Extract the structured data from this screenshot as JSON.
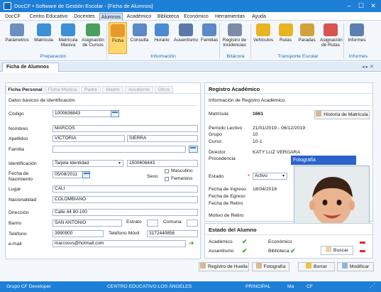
{
  "window": {
    "title": "DocCF • Software de Gestión Escolar - [Ficha de Alumnos]",
    "min": "–",
    "max": "☐",
    "close": "✕"
  },
  "menu": [
    "DocCF",
    "Centro Educativo",
    "Docentes",
    "Alumnos",
    "Académico",
    "Biblioteca",
    "Económico",
    "Herramientas",
    "Ayuda"
  ],
  "ribbon": {
    "buttons": [
      {
        "label": "Parámetros",
        "color": "#6c8fbf"
      },
      {
        "label": "Matrícula",
        "color": "#3d8fd6"
      },
      {
        "label": "Matrícula Masiva",
        "color": "#3d8fd6"
      },
      {
        "label": "Asignación de Cursos",
        "color": "#4aa05a"
      },
      {
        "label": "Ficha",
        "color": "#e79a2a"
      },
      {
        "label": "Consulta",
        "color": "#5b8ac4"
      },
      {
        "label": "Horario",
        "color": "#4a8ad0"
      },
      {
        "label": "Ausentismo",
        "color": "#5a79a8"
      },
      {
        "label": "Familias",
        "color": "#5b8ac4"
      },
      {
        "label": "Registro de Incidencias",
        "color": "#7a8da6"
      },
      {
        "label": "Vehículos",
        "color": "#e8b423"
      },
      {
        "label": "Rutas",
        "color": "#e8b423"
      },
      {
        "label": "Paradas",
        "color": "#d2a23a"
      },
      {
        "label": "Asignación de Rutas",
        "color": "#d9534f"
      },
      {
        "label": "Informes",
        "color": "#5a7fb0"
      }
    ],
    "groups": [
      "Preparación",
      "Información",
      "Bitácora",
      "Transporte Escolar",
      "Informes"
    ]
  },
  "doc_tab": "Ficha de Alumnos",
  "subtabs": [
    "Ficha Personal",
    "Ficha Médica",
    "Padre",
    "Madre",
    "Acudiente",
    "Otros"
  ],
  "personal": {
    "section": "Datos básicos de identificación.",
    "codigo_label": "Código",
    "codigo": "1000636843",
    "nombres_label": "Nombres",
    "nombres": "MARCOS",
    "apellidos_label": "Apellidos",
    "apellido1": "VICTORIA",
    "apellido2": "SIERRA",
    "familia_label": "Familia",
    "familia": "",
    "identificacion_label": "Identificación",
    "tipo_id": "Tarjeta Identidad",
    "numero_id": "1500606443",
    "fecha_nac_label": "Fecha de Nacimiento",
    "fecha_nac": "05/08/2011",
    "sexo_label": "Sexo",
    "masculino": "Masculino",
    "femenino": "Femenino",
    "lugar_label": "Lugar",
    "lugar": "CALI",
    "nacionalidad_label": "Nacionalidad",
    "nacionalidad": "COLOMBIANO",
    "direccion_label": "Dirección",
    "direccion": "Calle 44 80-100",
    "barrio_label": "Barrio",
    "barrio": "SAN ANTONIO",
    "estrato_label": "Estrato",
    "estrato": "",
    "comuna_label": "Comuna",
    "comuna": "",
    "telefono_label": "Teléfono",
    "telefono": "3990900",
    "movil_label": "Teléfono Móvil",
    "movil": "3172440856",
    "email_label": "e-mail",
    "email": "marcosvs@hotmail.com"
  },
  "academico": {
    "title": "Registro Académico",
    "info": "Información de Registro Académico.",
    "matricula_label": "Matrícula",
    "matricula": "1661",
    "historia_btn": "Historia de Matrícula",
    "periodo_label": "Período Lectivo",
    "periodo": "21/01/2019 - 06/12/2019",
    "grupo_label": "Grupo",
    "grupo": "10",
    "curso_label": "Curso",
    "curso": "10-1",
    "director_label": "Director",
    "director": "KATY LUZ  VERGARA",
    "procedencia_label": "Procedencia",
    "foto_header": "Fotografía",
    "estado_label": "Estado",
    "estado": "Activo",
    "fecha_ingreso_label": "Fecha de Ingreso",
    "fecha_ingreso": "18/04/2018",
    "fecha_egreso_label": "Fecha de Egreso",
    "fecha_retiro_label": "Fecha de Retiro",
    "motivo_label": "Motivo de Retiro"
  },
  "estado_alumno": {
    "title": "Estado del Alumno",
    "academico": "Académico",
    "economico": "Económico",
    "ausentismo": "Ausentismo",
    "biblioteca": "Biblioteca",
    "buscar": "Buscar"
  },
  "actions": {
    "huella": "Registro de Huella",
    "fotografia": "Fotografía",
    "borrar": "Borrar",
    "modificar": "Modificar"
  },
  "status": {
    "grupo": "Grupo CF Developer",
    "centro": "CENTRO EDUCATIVO LOS ÁNGELES",
    "principal": "PRINCIPAL",
    "user": "Ma",
    "brand": "CF"
  },
  "colors": {
    "accent": "#1e7fd6",
    "ribbon_active": "#ffd76a",
    "ok": "#3aa83a",
    "bad": "#e02c2c"
  }
}
